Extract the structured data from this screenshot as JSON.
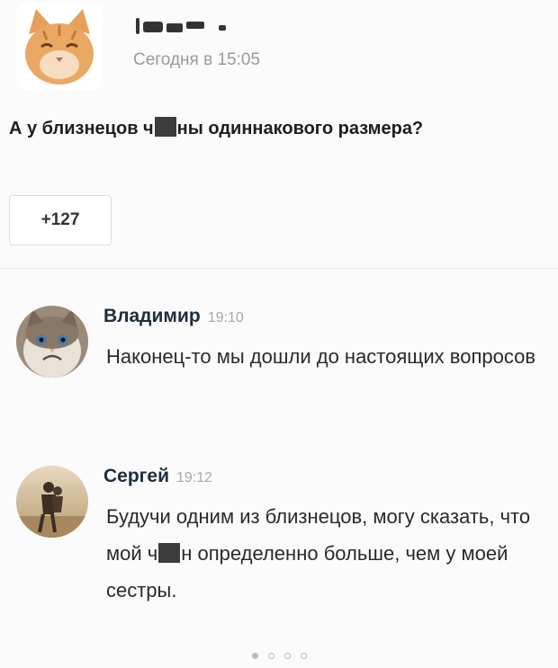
{
  "post": {
    "time": "Сегодня в 15:05",
    "text_before": "А у близнецов ч",
    "text_after": "ны одиннакового размера?",
    "likes": "+127"
  },
  "comments": [
    {
      "name": "Владимир",
      "time": "19:10",
      "text": "Наконец-то мы дошли до настоящих вопросов",
      "avatar_icon": "grumpy-cat-avatar"
    },
    {
      "name": "Сергей",
      "time": "19:12",
      "text_before": "Будучи одним из близнецов, могу сказать, что мой ч",
      "text_after": "н определенно больше, чем у моей сестры.",
      "avatar_icon": "couple-photo-avatar"
    }
  ],
  "pager": {
    "pages": 4,
    "active": 1
  },
  "colors": {
    "background": "#fbfbfb",
    "time": "#9a9a9a",
    "name": "#1e2d3c"
  }
}
